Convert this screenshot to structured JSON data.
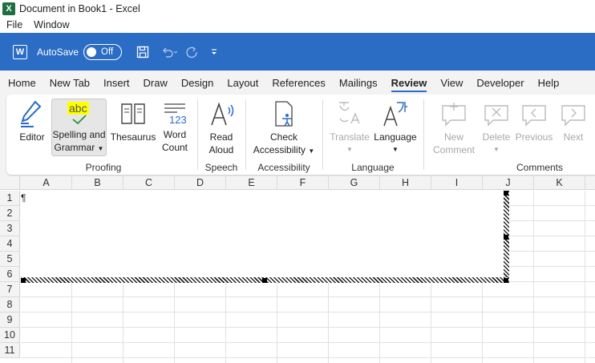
{
  "window": {
    "title": "Document in Book1 - Excel",
    "app_logo": "X"
  },
  "menu": {
    "items": [
      "File",
      "Window"
    ]
  },
  "qat": {
    "word_logo": "W",
    "autosave_label": "AutoSave",
    "toggle_state": "Off"
  },
  "tabs": {
    "items": [
      "Home",
      "New Tab",
      "Insert",
      "Draw",
      "Design",
      "Layout",
      "References",
      "Mailings",
      "Review",
      "View",
      "Developer",
      "Help"
    ],
    "active": "Review"
  },
  "ribbon": {
    "editor": "Editor",
    "spelling_line1": "Spelling and",
    "spelling_line2": "Grammar",
    "spelling_icon_text": "abc",
    "thesaurus": "Thesaurus",
    "word_count_line1": "Word",
    "word_count_line2": "Count",
    "word_count_icon_text": "123",
    "read_aloud_line1": "Read",
    "read_aloud_line2": "Aloud",
    "check_acc_line1": "Check",
    "check_acc_line2": "Accessibility",
    "translate": "Translate",
    "language": "Language",
    "new_comment_line1": "New",
    "new_comment_line2": "Comment",
    "delete": "Delete",
    "previous": "Previous",
    "next": "Next",
    "groups": {
      "proofing": "Proofing",
      "speech": "Speech",
      "accessibility": "Accessibility",
      "language": "Language",
      "comments": "Comments"
    }
  },
  "sheet": {
    "columns": [
      "A",
      "B",
      "C",
      "D",
      "E",
      "F",
      "G",
      "H",
      "I",
      "J",
      "K"
    ],
    "rows": [
      "1",
      "2",
      "3",
      "4",
      "5",
      "6",
      "7",
      "8",
      "9",
      "10",
      "11"
    ],
    "embedded_text": "¶"
  },
  "colors": {
    "accent": "#2b6cc4",
    "excel_green": "#1d6f42",
    "highlight": "#ffff00"
  }
}
